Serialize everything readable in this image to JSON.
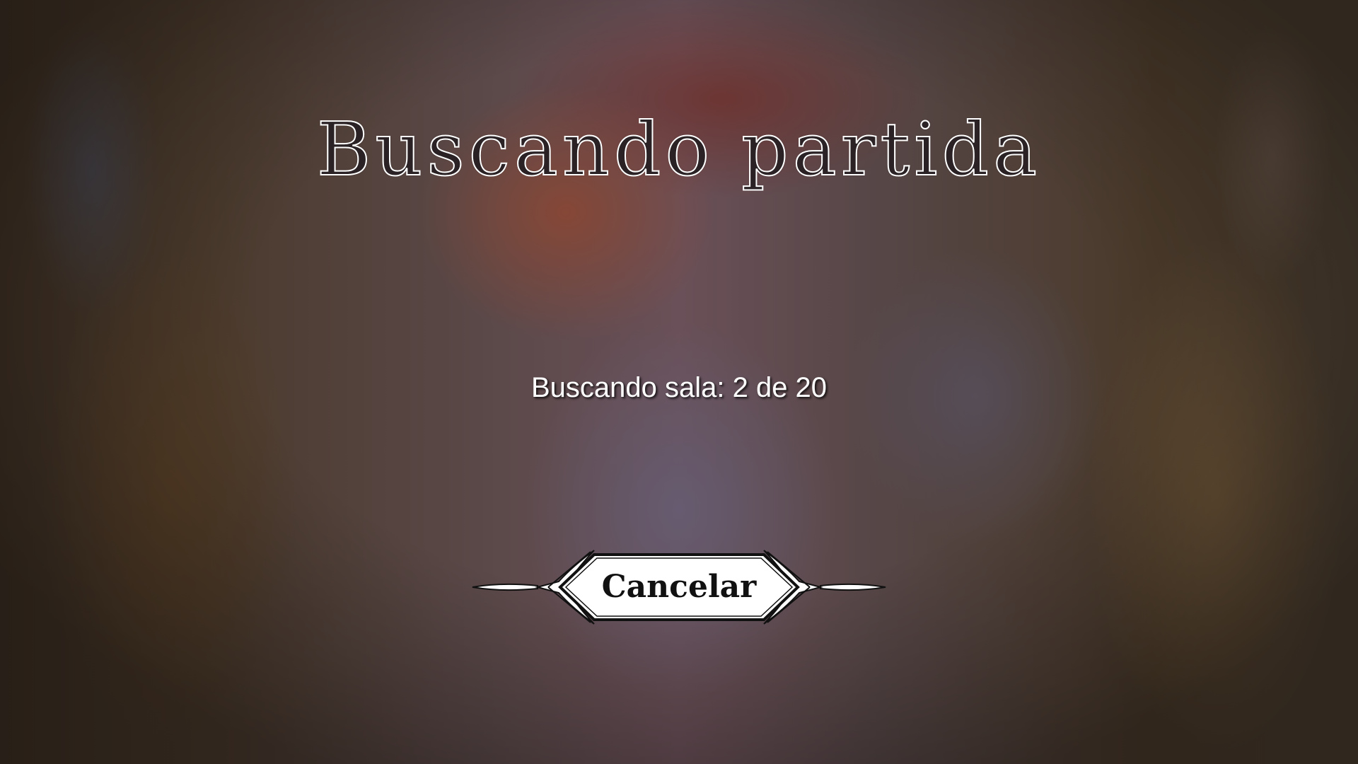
{
  "screen": {
    "title": "Buscando partida",
    "status": "Buscando sala: 2 de 20"
  },
  "buttons": {
    "cancel_label": "Cancelar"
  },
  "colors": {
    "text": "#ffffff",
    "button_fill": "#ffffff",
    "button_stroke": "#111111"
  }
}
